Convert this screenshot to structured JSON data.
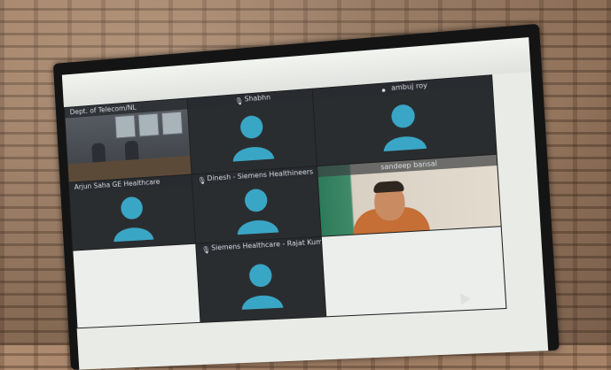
{
  "tiles": [
    {
      "id": "room",
      "label": "Dept. of Telecom/NL"
    },
    {
      "id": "shabhn",
      "label": "Shabhn"
    },
    {
      "id": "ambuj",
      "label": "ambuj roy"
    },
    {
      "id": "arjun",
      "label": "Arjun Saha GE Healthcare"
    },
    {
      "id": "dinesh",
      "label": "Dinesh - Siemens Healthineers"
    },
    {
      "id": "sandeep",
      "label": "sandeep bansal"
    },
    {
      "id": "blank_left",
      "label": ""
    },
    {
      "id": "rajat",
      "label": "Siemens Healthcare - Rajat Kumar"
    },
    {
      "id": "blank_right",
      "label": ""
    }
  ],
  "colors": {
    "avatar": "#3aa6c6",
    "tile_bg": "#2a2d2f",
    "bar_text": "#d8dde2"
  },
  "icons": {
    "avatar": "person-silhouette-icon",
    "mic": "microphone-icon",
    "video": "video-camera-icon",
    "cursor": "mouse-pointer-icon"
  }
}
